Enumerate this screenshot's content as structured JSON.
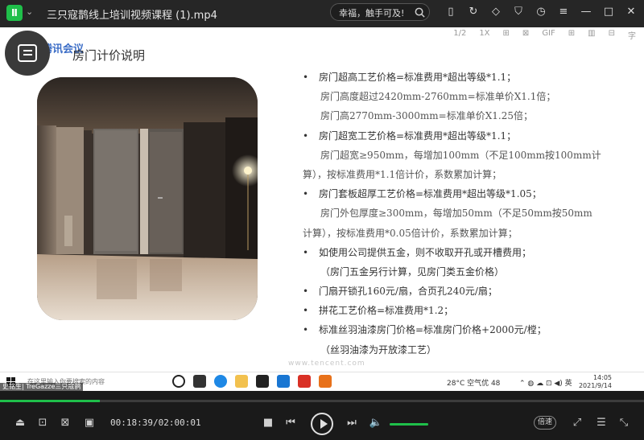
{
  "player": {
    "title": "三只寇鹊线上培训视频课程 (1).mp4",
    "search_text": "幸福，触手可及!",
    "accent": "#1fbf4a"
  },
  "overlay": {
    "top_items": [
      "1/2",
      "1X",
      "⊞",
      "⊠",
      "GIF",
      "⊞",
      "▥",
      "⊟",
      "字"
    ],
    "brand": "腾讯会议"
  },
  "slide": {
    "title": "房门计价说明",
    "lines": [
      {
        "level": 1,
        "text": "房门超高工艺价格=标准费用*超出等级*1.1；"
      },
      {
        "level": 2,
        "text": "房门高度超过2420mm-2760mm=标准单价X1.1倍；"
      },
      {
        "level": 2,
        "text": "房门高2770mm-3000mm=标准单价X1.25倍；"
      },
      {
        "level": 1,
        "text": "房门超宽工艺价格=标准费用*超出等级*1.1；"
      },
      {
        "level": 2,
        "text": "房门超宽≥950mm，每增加100mm（不足100mm按100mm计"
      },
      {
        "level": 3,
        "text": "算），按标准费用*1.1倍计价，系数累加计算；"
      },
      {
        "level": 1,
        "text": "房门套板超厚工艺价格=标准费用*超出等级*1.05；"
      },
      {
        "level": 2,
        "text": "房门外包厚度≥300mm，每增加50mm（不足50mm按50mm"
      },
      {
        "level": 3,
        "text": "计算），按标准费用*0.05倍计价，系数累加计算；"
      },
      {
        "level": 1,
        "text": "如使用公司提供五金，则不收取开孔或开槽费用；"
      },
      {
        "level": 4,
        "text": "（房门五金另行计算，见房门类五金价格）"
      },
      {
        "level": 1,
        "text": "门扇开锁孔160元/扇，合页孔240元/扇；"
      },
      {
        "level": 1,
        "text": "拼花工艺价格=标准费用*1.2；"
      },
      {
        "level": 1,
        "text": "标准丝羽油漆房门价格=标准房门价格+2000元/樘；"
      },
      {
        "level": 4,
        "text": "（丝羽油漆为开放漆工艺）"
      }
    ],
    "watermark": "www.tencent.com"
  },
  "taskbar": {
    "search_placeholder": "在这里输入你要搜索的内容",
    "weather": "28°C 空气优 48",
    "tray": "⌃ ◍ ☁ ⊡ ◀) 英",
    "time": "14:05",
    "date": "2021/9/14"
  },
  "caption": "史铭生| TreGazze三只寇鹊",
  "controls": {
    "current_time": "00:18:39",
    "total_time": "02:00:01",
    "time_display": "00:18:39/02:00:01",
    "progress": 0.155,
    "volume": 1.0,
    "speed_label": "倍速"
  }
}
